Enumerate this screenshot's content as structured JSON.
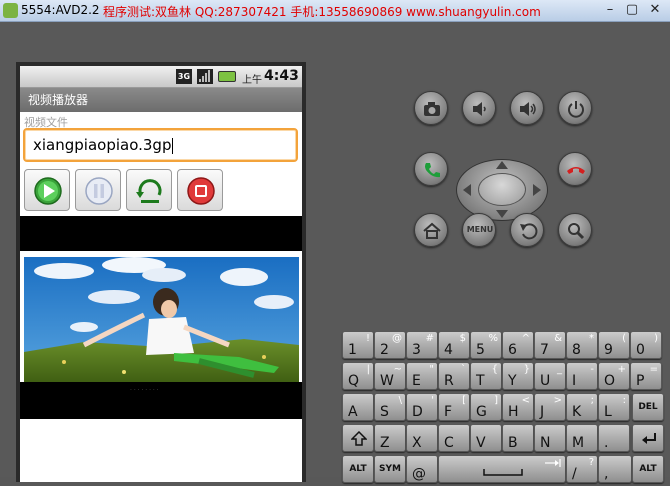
{
  "window": {
    "title": "5554:AVD2.2",
    "banner": "程序测试:双鱼林  QQ:287307421  手机:13558690869  www.shuangyulin.com",
    "minimize": "–",
    "restore": "▢",
    "close": "✕"
  },
  "statusbar": {
    "network": "3G",
    "ampm": "上午",
    "time": "4:43"
  },
  "app": {
    "title": "视频播放器",
    "label": "视频文件",
    "filename": "xiangpiaopiao.3gp",
    "caption": "· · · · · · · ·"
  },
  "controls": {
    "menu": "MENU"
  },
  "keyboard": {
    "row1": [
      {
        "m": "1",
        "s": "!"
      },
      {
        "m": "2",
        "s": "@"
      },
      {
        "m": "3",
        "s": "#"
      },
      {
        "m": "4",
        "s": "$"
      },
      {
        "m": "5",
        "s": "%"
      },
      {
        "m": "6",
        "s": "^"
      },
      {
        "m": "7",
        "s": "&"
      },
      {
        "m": "8",
        "s": "*"
      },
      {
        "m": "9",
        "s": "("
      },
      {
        "m": "0",
        "s": ")"
      }
    ],
    "row2": [
      {
        "m": "Q",
        "s": "|"
      },
      {
        "m": "W",
        "s": "~"
      },
      {
        "m": "E",
        "s": "\""
      },
      {
        "m": "R",
        "s": "`"
      },
      {
        "m": "T",
        "s": "{"
      },
      {
        "m": "Y",
        "s": "}"
      },
      {
        "m": "U",
        "s": "_"
      },
      {
        "m": "I",
        "s": "-"
      },
      {
        "m": "O",
        "s": "+"
      },
      {
        "m": "P",
        "s": "="
      }
    ],
    "row3": [
      {
        "m": "A",
        "s": ""
      },
      {
        "m": "S",
        "s": "\\"
      },
      {
        "m": "D",
        "s": "'"
      },
      {
        "m": "F",
        "s": "["
      },
      {
        "m": "G",
        "s": "]"
      },
      {
        "m": "H",
        "s": "<"
      },
      {
        "m": "J",
        "s": ">"
      },
      {
        "m": "K",
        "s": ";"
      },
      {
        "m": "L",
        "s": ":"
      }
    ],
    "row4": [
      {
        "m": "Z",
        "s": ""
      },
      {
        "m": "X",
        "s": ""
      },
      {
        "m": "C",
        "s": ""
      },
      {
        "m": "V",
        "s": ""
      },
      {
        "m": "B",
        "s": ""
      },
      {
        "m": "N",
        "s": ""
      },
      {
        "m": "M",
        "s": ""
      },
      {
        "m": ".",
        "s": ""
      }
    ],
    "del": "DEL",
    "alt_left": "ALT",
    "sym": "SYM",
    "at": "@",
    "slash": "/",
    "question": "?",
    "comma": ",",
    "alt_right": "ALT"
  }
}
